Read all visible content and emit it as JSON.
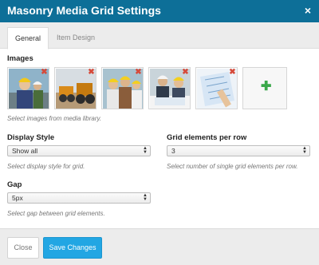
{
  "dialog": {
    "title": "Masonry Media Grid Settings",
    "close_glyph": "×"
  },
  "tabs": [
    {
      "label": "General",
      "active": true
    },
    {
      "label": "Item Design",
      "active": false
    }
  ],
  "images": {
    "label": "Images",
    "helper": "Select images from media library.",
    "thumbnails": [
      {
        "name": "thumb-engineer-hardhat",
        "remove": "✖"
      },
      {
        "name": "thumb-construction-machinery",
        "remove": "✖"
      },
      {
        "name": "thumb-engineers-group",
        "remove": "✖"
      },
      {
        "name": "thumb-engineers-reviewing-plans",
        "remove": "✖"
      },
      {
        "name": "thumb-blueprint-drawing",
        "remove": "✖"
      }
    ],
    "add_glyph": "✚"
  },
  "display_style": {
    "label": "Display Style",
    "value": "Show all",
    "helper": "Select display style for grid."
  },
  "grid_elements": {
    "label": "Grid elements per row",
    "value": "3",
    "helper": "Select number of single grid elements per row."
  },
  "gap": {
    "label": "Gap",
    "value": "5px",
    "helper": "Select gap between grid elements."
  },
  "footer": {
    "close_label": "Close",
    "save_label": "Save Changes"
  },
  "colors": {
    "titlebar": "#0d6f98",
    "primary_button": "#22a6e3",
    "remove_icon": "#d64a3a",
    "add_icon": "#3aa84a"
  }
}
